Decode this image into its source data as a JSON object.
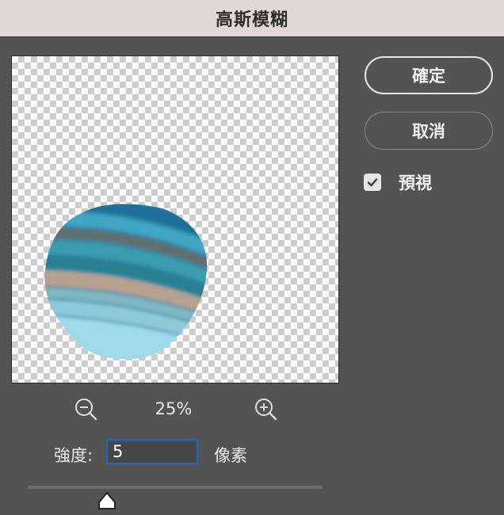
{
  "dialog": {
    "title": "高斯模糊"
  },
  "buttons": {
    "ok_label": "確定",
    "cancel_label": "取消"
  },
  "preview_option": {
    "label": "預視",
    "checked": true
  },
  "zoom": {
    "value": "25%",
    "zoom_out_icon": "zoom-out-magnifier",
    "zoom_in_icon": "zoom-in-magnifier"
  },
  "strength": {
    "label": "強度:",
    "value": "5",
    "unit": "像素",
    "slider_fraction": 0.27
  },
  "colors": {
    "background": "#535353",
    "title_bar": "#e1d7d6",
    "input_focus": "#1a68c9"
  }
}
